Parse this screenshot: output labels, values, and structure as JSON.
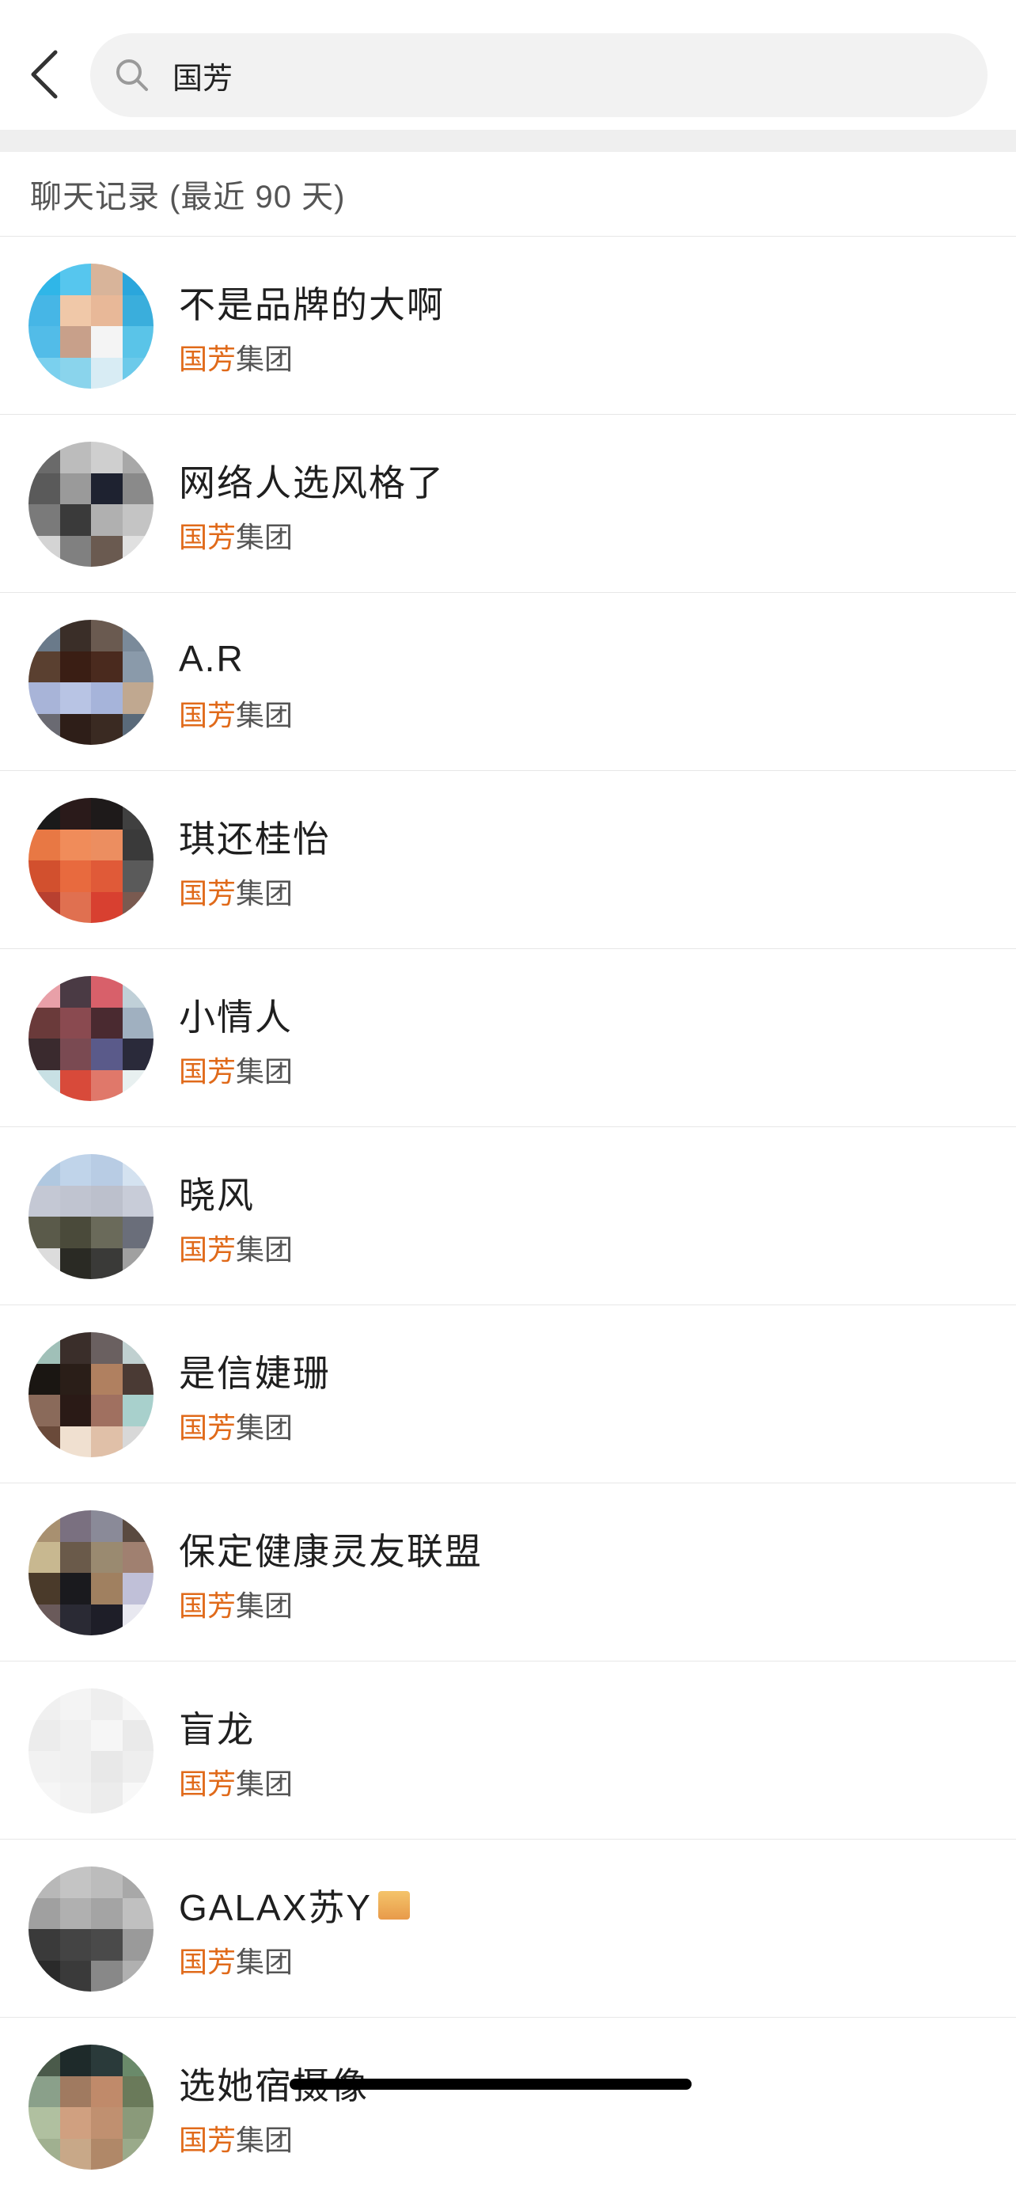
{
  "search": {
    "query": "国芳"
  },
  "section": {
    "title": "聊天记录 (最近 90 天)"
  },
  "results": [
    {
      "name": "不是品牌的大啊",
      "match": "国芳",
      "rest": "集团",
      "avatar": [
        "#2fb6e8",
        "#56c6ee",
        "#d8b49a",
        "#2aa6dc",
        "#46b6e6",
        "#f0c8a8",
        "#e8b898",
        "#3aaedc",
        "#52bce8",
        "#c8a08a",
        "#f4f4f4",
        "#5ac4e8",
        "#7ad0ee",
        "#8ad4ec",
        "#d8ecf4",
        "#6ccaea"
      ]
    },
    {
      "name": "网络人选风格了",
      "match": "国芳",
      "rest": "集团",
      "avatar": [
        "#6a6a6a",
        "#bcbcbc",
        "#cfcfcf",
        "#a8a8a8",
        "#5a5a5a",
        "#9a9a9a",
        "#1e2230",
        "#8a8a8a",
        "#7a7a7a",
        "#3a3a3a",
        "#b0b0b0",
        "#c4c4c4",
        "#d4d4d4",
        "#808080",
        "#6a5a50",
        "#e0e0e0"
      ]
    },
    {
      "name": "A.R",
      "match": "国芳",
      "rest": "集团",
      "avatar": [
        "#6a7a8a",
        "#3a2e28",
        "#6a5a50",
        "#7a8a9a",
        "#5a4030",
        "#3a1e14",
        "#4a2a1e",
        "#8a9aaa",
        "#a8b4d8",
        "#b8c4e4",
        "#a6b4da",
        "#c0a890",
        "#6a6a72",
        "#2e1e18",
        "#3a2a22",
        "#5a6a7a"
      ]
    },
    {
      "name": "琪还桂怡",
      "match": "国芳",
      "rest": "集团",
      "avatar": [
        "#1a1a1a",
        "#2a1a1a",
        "#1e1a1a",
        "#404040",
        "#e87844",
        "#f08c5a",
        "#ec8e60",
        "#3a3a3a",
        "#d2502e",
        "#e86a3e",
        "#e05a38",
        "#5a5a5a",
        "#b84030",
        "#e07050",
        "#d84030",
        "#7a5a50"
      ]
    },
    {
      "name": "小情人",
      "match": "国芳",
      "rest": "集团",
      "avatar": [
        "#e8a0a8",
        "#4a3a44",
        "#d8606a",
        "#c0d0d8",
        "#6a3a3a",
        "#8a4a50",
        "#4a2a30",
        "#a0b0c0",
        "#3a2a2e",
        "#7a4a52",
        "#5a5a8a",
        "#2a2a3a",
        "#c8e0e4",
        "#d84a3a",
        "#e0786a",
        "#e8f0f0"
      ]
    },
    {
      "name": "晓风",
      "match": "国芳",
      "rest": "集团",
      "avatar": [
        "#b0c8e0",
        "#c0d4ea",
        "#b8cce4",
        "#d4e2f0",
        "#c4c8d4",
        "#c0c4d0",
        "#bcc0cc",
        "#c8ccd8",
        "#5a5a4a",
        "#4a4a3a",
        "#6a6a5a",
        "#6a6e7a",
        "#dcdcdc",
        "#2a2a24",
        "#3a3a38",
        "#a0a0a0"
      ]
    },
    {
      "name": "是信婕珊",
      "match": "国芳",
      "rest": "集团",
      "avatar": [
        "#a0c0b8",
        "#3a2e2a",
        "#6a6060",
        "#c0d0d0",
        "#1a1612",
        "#2a1e18",
        "#b08060",
        "#4a3a34",
        "#8a6a5a",
        "#2a1a16",
        "#a07060",
        "#a8d0cc",
        "#6a4a3a",
        "#f0e0d0",
        "#e0c0a8",
        "#d8d8d8"
      ]
    },
    {
      "name": "保定健康灵友联盟",
      "match": "国芳",
      "rest": "集团",
      "avatar": [
        "#a89070",
        "#7a7080",
        "#8a8a98",
        "#5a4a40",
        "#c8b890",
        "#6a5a4a",
        "#9a8a70",
        "#a08070",
        "#4a3a2a",
        "#1a1a1e",
        "#a08060",
        "#c0c0d8",
        "#6a5a5a",
        "#2a2a34",
        "#1e1e28",
        "#e8e8f0"
      ]
    },
    {
      "name": "盲龙",
      "match": "国芳",
      "rest": "集团",
      "avatar": [
        "#f0f0f0",
        "#f4f4f4",
        "#eeeeee",
        "#f6f6f6",
        "#ececec",
        "#f0f0f0",
        "#f6f6f6",
        "#eaeaea",
        "#f2f2f2",
        "#f0f0f0",
        "#e8e8e8",
        "#eeeeee",
        "#f6f6f6",
        "#f2f2f2",
        "#ececec",
        "#f8f8f8"
      ]
    },
    {
      "name": "GALAX苏Y",
      "match": "国芳",
      "rest": "集团",
      "avatar": [
        "#b8b8b8",
        "#c4c4c4",
        "#bcbcbc",
        "#a8a8a8",
        "#a0a0a0",
        "#b0b0b0",
        "#a4a4a4",
        "#c0c0c0",
        "#3a3a3a",
        "#444444",
        "#4a4a4a",
        "#9a9a9a",
        "#2a2a2a",
        "#3a3a3a",
        "#888888",
        "#b0b0b0"
      ]
    },
    {
      "name": "选她宿摄像",
      "match": "国芳",
      "rest": "集团",
      "avatar": [
        "#4a5a4a",
        "#1e2a2a",
        "#2a3a3a",
        "#6a8a6a",
        "#8aa08a",
        "#a07a60",
        "#c08a6a",
        "#6a7a5a",
        "#b0c0a0",
        "#d0a080",
        "#c09070",
        "#8a9a7a",
        "#a0b090",
        "#c8a888",
        "#b08868",
        "#9aaa8a"
      ]
    }
  ]
}
